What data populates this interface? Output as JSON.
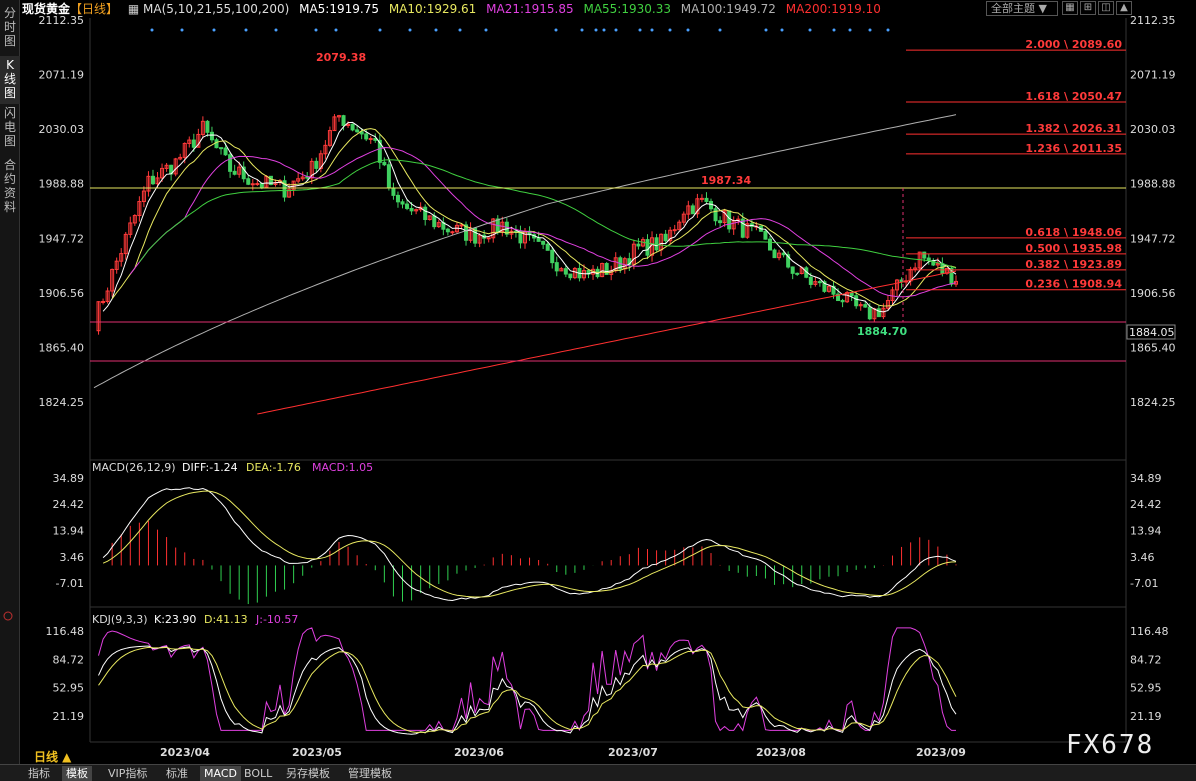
{
  "left_tabs": [
    "分时图",
    "K线图",
    "闪电图",
    "合约资料"
  ],
  "header": {
    "symbol": "现货黄金",
    "period_tag": "【日线】",
    "ma_label": "MA(5,10,21,55,100,200)",
    "ma_values": [
      {
        "label": "MA5:1919.75",
        "color": "#ffffff"
      },
      {
        "label": "MA10:1929.61",
        "color": "#e8e860"
      },
      {
        "label": "MA21:1915.85",
        "color": "#e040e0"
      },
      {
        "label": "MA55:1930.33",
        "color": "#40d040"
      },
      {
        "label": "MA100:1949.72",
        "color": "#b0b0b0"
      },
      {
        "label": "MA200:1919.10",
        "color": "#ff3030"
      }
    ],
    "dropdown": "全部主题",
    "dropdown_icon": "caret-down-icon"
  },
  "price_axis": [
    "2112.35",
    "2071.19",
    "2030.03",
    "1988.88",
    "1947.72",
    "1906.56",
    "1865.40",
    "1824.25"
  ],
  "current_price": "1884.05",
  "annotations": {
    "high": "2079.38",
    "mid": "1987.34",
    "low": "1884.70"
  },
  "fib_levels": [
    {
      "label": "2.000 \\ 2089.60",
      "price": 2089.6
    },
    {
      "label": "1.618 \\ 2050.47",
      "price": 2050.47
    },
    {
      "label": "1.382 \\ 2026.31",
      "price": 2026.31
    },
    {
      "label": "1.236 \\ 2011.35",
      "price": 2011.35
    },
    {
      "label": "0.618 \\ 1948.06",
      "price": 1948.06
    },
    {
      "label": "0.500 \\ 1935.98",
      "price": 1935.98
    },
    {
      "label": "0.382 \\ 1923.89",
      "price": 1923.89
    },
    {
      "label": "0.236 \\ 1908.94",
      "price": 1908.94
    }
  ],
  "macd": {
    "title": "MACD(26,12,9)",
    "diff": "DIFF:-1.24",
    "dea": "DEA:-1.76",
    "macd": "MACD:1.05",
    "axis": [
      "34.89",
      "24.42",
      "13.94",
      "3.46",
      "-7.01"
    ]
  },
  "kdj": {
    "title": "KDJ(9,3,3)",
    "k": "K:23.90",
    "d": "D:41.13",
    "j": "J:-10.57",
    "axis": [
      "116.48",
      "84.72",
      "52.95",
      "21.19"
    ]
  },
  "dates": [
    "2023/04",
    "2023/05",
    "2023/06",
    "2023/07",
    "2023/08",
    "2023/09"
  ],
  "period_label": "日线 ▲",
  "bottom_tabs": [
    "指标",
    "模板",
    "VIP指标",
    "标准",
    "MACD",
    "BOLL",
    "另存模板",
    "管理模板"
  ],
  "watermark": "FX678"
}
